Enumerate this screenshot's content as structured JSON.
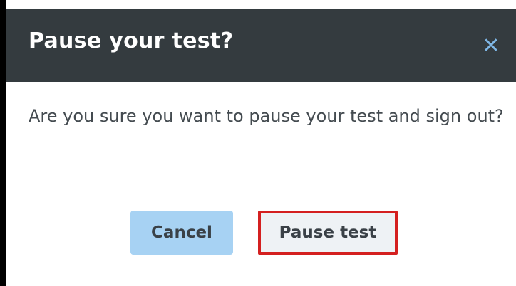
{
  "dialog": {
    "title": "Pause your test?",
    "close_icon": "close-icon",
    "message": "Are you sure you want to pause your test and sign out?",
    "buttons": {
      "cancel_label": "Cancel",
      "pause_label": "Pause test"
    }
  },
  "colors": {
    "header_bg": "#343b3f",
    "close_icon": "#7fb7e6",
    "cancel_bg": "#a7d2f3",
    "pause_border": "#d42020",
    "body_text": "#444b50"
  }
}
